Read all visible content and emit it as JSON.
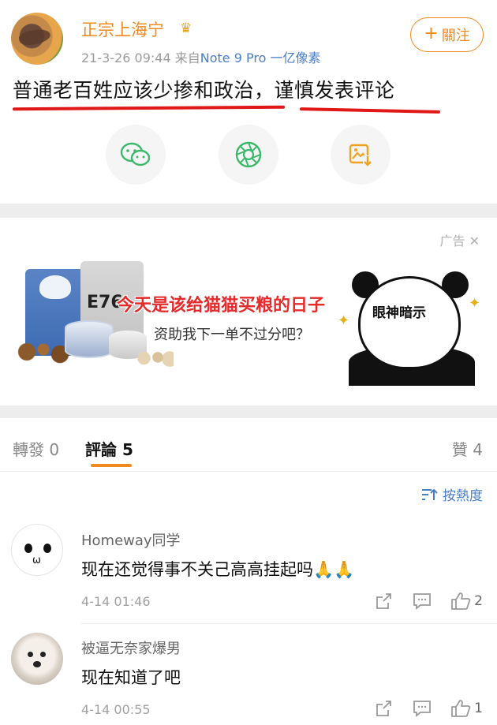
{
  "post": {
    "username": "正宗上海宁",
    "timestamp": "21-3-26 09:44",
    "source_prefix": "来自",
    "device": "Note 9 Pro 一亿像素",
    "follow_label": "關注",
    "follow_plus": "+",
    "text_part1": "普通老百姓应该少掺和政治",
    "text_sep": "，",
    "text_part2": "谨慎发表评论",
    "underline_color": "#e01818",
    "share_icons": [
      "wechat-icon",
      "moments-icon",
      "save-image-icon"
    ]
  },
  "ad": {
    "label": "广告",
    "close_glyph": "✕",
    "bag_text": "E76",
    "headline": "今天是该给猫猫买粮的日子",
    "subtext": "资助我下一单不过分吧？",
    "panda_text": "眼神暗示"
  },
  "tabs": {
    "repost_label": "轉發",
    "repost_count": "0",
    "comments_label": "評論",
    "comments_count": "5",
    "likes_label": "贊",
    "likes_count": "4",
    "active": "comments",
    "accent": "#f0891e"
  },
  "sort": {
    "label": "按熱度"
  },
  "comments": [
    {
      "name": "Homeway同学",
      "text": "现在还觉得事不关己高高挂起吗",
      "emoji": "🙏🙏",
      "time": "4-14 01:46",
      "likes": "2"
    },
    {
      "name": "被逼无奈家爆男",
      "text": "现在知道了吧",
      "time": "4-14 00:55",
      "likes": "1"
    }
  ],
  "colors": {
    "brand_orange": "#f0891e",
    "link_blue": "#4a7ec7",
    "divider": "#ededed"
  }
}
